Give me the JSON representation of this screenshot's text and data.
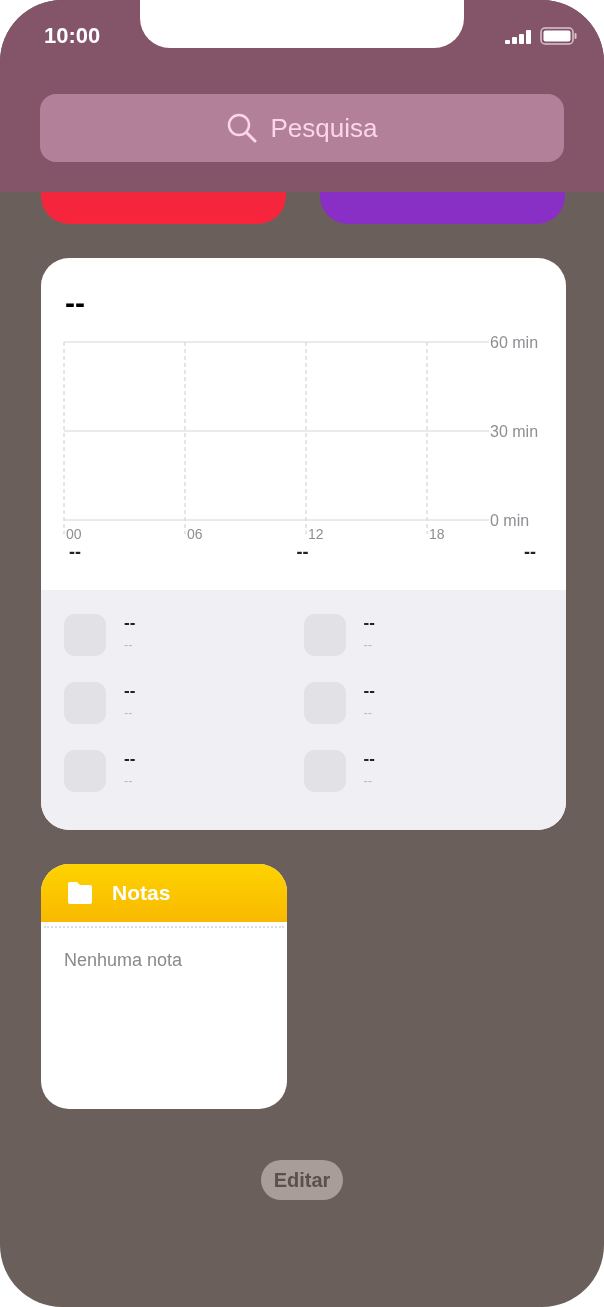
{
  "status_bar": {
    "time": "10:00"
  },
  "search": {
    "placeholder": "Pesquisa"
  },
  "partial_widgets": [
    {
      "color": "#f8243c"
    },
    {
      "color": "#8a2ec8"
    }
  ],
  "screen_time_widget": {
    "title": "--",
    "chart_data": {
      "type": "bar",
      "categories": [
        "00",
        "06",
        "12",
        "18"
      ],
      "ylim": [
        0,
        60
      ],
      "yticks": [
        {
          "value": 0,
          "label": "0 min"
        },
        {
          "value": 30,
          "label": "30 min"
        },
        {
          "value": 60,
          "label": "60 min"
        }
      ]
    },
    "summary": [
      "--",
      "--",
      "--"
    ],
    "apps": [
      {
        "name": "--",
        "detail": "--"
      },
      {
        "name": "--",
        "detail": "--"
      },
      {
        "name": "--",
        "detail": "--"
      },
      {
        "name": "--",
        "detail": "--"
      },
      {
        "name": "--",
        "detail": "--"
      },
      {
        "name": "--",
        "detail": "--"
      }
    ]
  },
  "notes_widget": {
    "title": "Notas",
    "empty_text": "Nenhuma nota"
  },
  "edit_button": {
    "label": "Editar"
  }
}
